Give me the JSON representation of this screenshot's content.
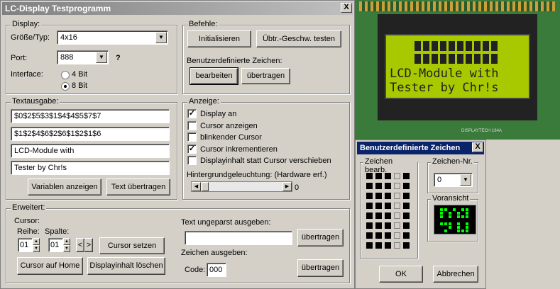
{
  "main_window": {
    "title": "LC-Display Testprogramm",
    "close_label": "X",
    "display_group": {
      "title": "Display:",
      "size_label": "Größe/Typ:",
      "size_value": "4x16",
      "port_label": "Port:",
      "port_value": "888",
      "port_help": "?",
      "interface_label": "Interface:",
      "interface_options": [
        "4 Bit",
        "8 Bit"
      ],
      "interface_selected": "8 Bit"
    },
    "befehle_group": {
      "title": "Befehle:",
      "init_label": "Initialisieren",
      "speed_label": "Übtr.-Geschw. testen",
      "custom_label": "Benutzerdefinierte Zeichen:",
      "edit_label": "bearbeiten",
      "transfer_label": "übertragen"
    },
    "textausgabe_group": {
      "title": "Textausgabe:",
      "lines": [
        "$0$2$5$3$1$4$4$5$7$7",
        "$1$2$4$6$2$6$1$2$1$6",
        "LCD-Module with",
        "Tester by Chr!s"
      ],
      "vars_label": "Variablen anzeigen",
      "send_label": "Text übertragen"
    },
    "anzeige_group": {
      "title": "Anzeige:",
      "checks": [
        {
          "label": "Display an",
          "checked": true
        },
        {
          "label": "Cursor anzeigen",
          "checked": false
        },
        {
          "label": "blinkender Cursor",
          "checked": false
        },
        {
          "label": "Cursor inkrementieren",
          "checked": true
        },
        {
          "label": "Displayinhalt statt Cursor verschieben",
          "checked": false
        }
      ],
      "backlight_label": "Hintergrundgeleuchtung: (Hardware erf.)",
      "backlight_value": "0"
    },
    "erweitert_group": {
      "title": "Erweitert:",
      "cursor_label": "Cursor:",
      "row_label": "Reihe:",
      "row_value": "01",
      "col_label": "Spalte:",
      "col_value": "01",
      "set_cursor_label": "Cursor setzen",
      "home_label": "Cursor auf Home",
      "clear_label": "Displayinhalt löschen",
      "raw_label": "Text ungeparst ausgeben:",
      "raw_value": "",
      "raw_send_label": "übertragen",
      "char_out_label": "Zeichen ausgeben:",
      "code_label": "Code:",
      "code_value": "000",
      "char_send_label": "übertragen"
    }
  },
  "lcd_photo": {
    "lines": [
      "LCD-Module with",
      "Tester by Chr!s"
    ],
    "brand": "DISPLAYTECH 164A"
  },
  "char_dialog": {
    "title": "Benutzerdefinierte Zeichen",
    "close_label": "X",
    "edit_group": "Zeichen bearb.",
    "nr_group": "Zeichen-Nr.",
    "nr_value": "0",
    "preview_group": "Voransicht",
    "ok_label": "OK",
    "cancel_label": "Abbrechen"
  }
}
